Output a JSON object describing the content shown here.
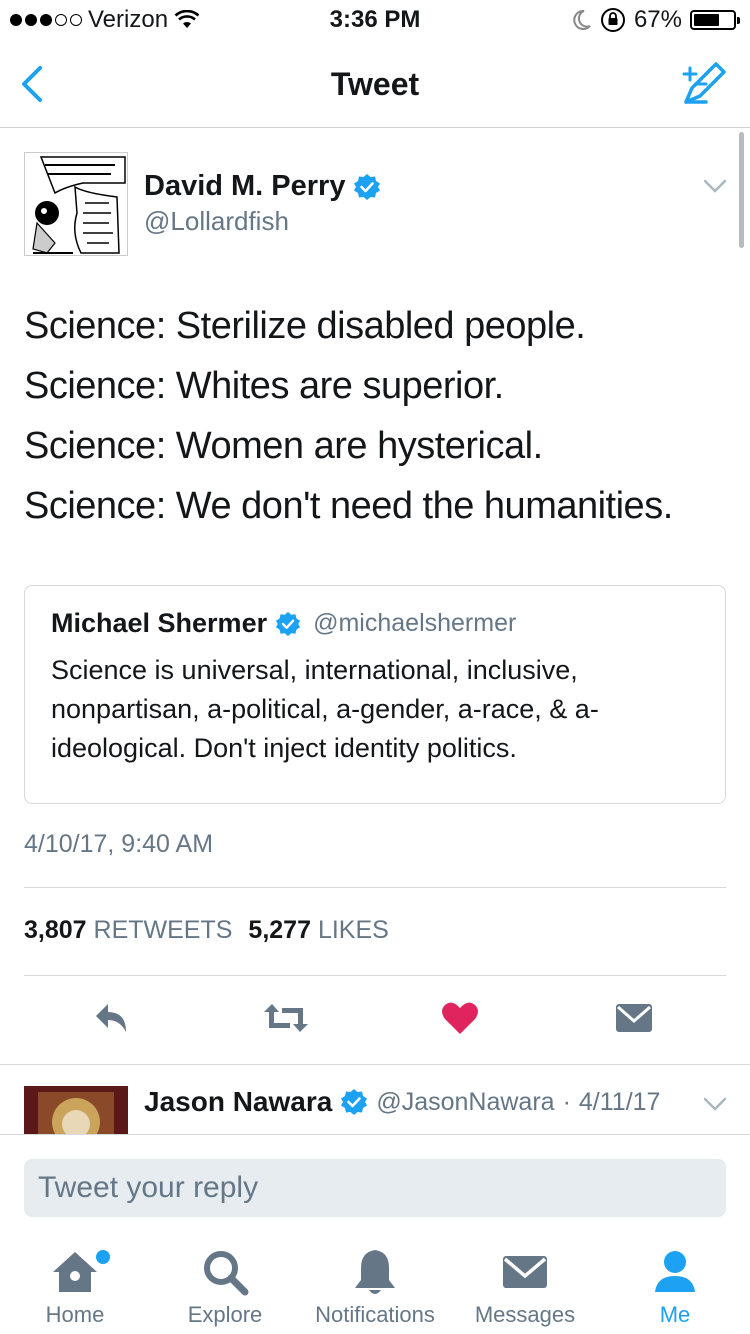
{
  "status_bar": {
    "carrier": "Verizon",
    "time": "3:36 PM",
    "battery": "67%",
    "battery_level": 0.67
  },
  "nav": {
    "title": "Tweet"
  },
  "tweet": {
    "author_name": "David M. Perry",
    "author_handle": "@Lollardfish",
    "lines": [
      "Science: Sterilize disabled people.",
      "Science: Whites are superior.",
      "Science: Women are hysterical.",
      "Science: We don't need the humanities."
    ],
    "timestamp": "4/10/17, 9:40 AM",
    "retweets": "3,807",
    "retweets_label": "RETWEETS",
    "likes": "5,277",
    "likes_label": "LIKES"
  },
  "quote": {
    "name": "Michael Shermer",
    "handle": "@michaelshermer",
    "text": "Science is universal, international, inclusive, nonpartisan, a-political, a-gender, a-race, & a-ideological. Don't inject identity politics."
  },
  "reply_preview": {
    "name": "Jason Nawara",
    "handle": "@JasonNawara",
    "date": "4/11/17"
  },
  "reply_box": {
    "placeholder": "Tweet your reply"
  },
  "tabs": [
    {
      "label": "Home",
      "icon": "home-icon"
    },
    {
      "label": "Explore",
      "icon": "search-icon"
    },
    {
      "label": "Notifications",
      "icon": "bell-icon"
    },
    {
      "label": "Messages",
      "icon": "envelope-icon"
    },
    {
      "label": "Me",
      "icon": "person-icon"
    }
  ],
  "colors": {
    "accent": "#1da1f2",
    "like": "#e0245e",
    "muted": "#657786",
    "verified": "#1da1f2"
  }
}
